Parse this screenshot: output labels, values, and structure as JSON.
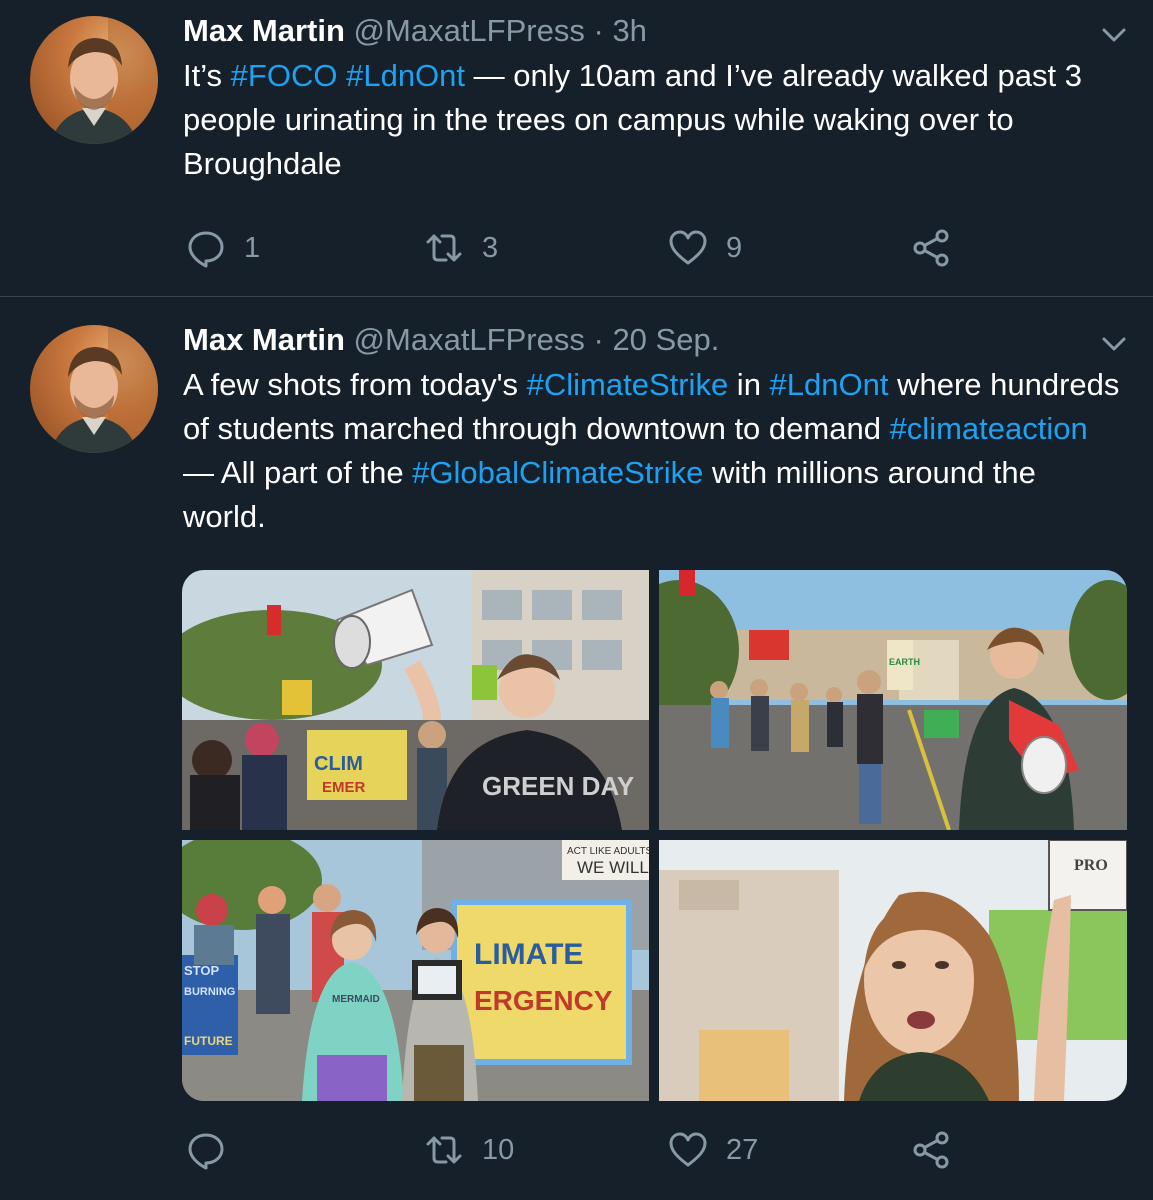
{
  "tweets": [
    {
      "author_name": "Max Martin",
      "handle": "@MaxatLFPress",
      "separator": "·",
      "time": "3h",
      "text_segments": [
        {
          "t": "It’s ",
          "tag": false
        },
        {
          "t": "#FOCO",
          "tag": true
        },
        {
          "t": " ",
          "tag": false
        },
        {
          "t": "#LdnOnt",
          "tag": true
        },
        {
          "t": " — only 10am and I’ve already walked past 3 people urinating in the trees on campus while waking over to Broughdale",
          "tag": false
        }
      ],
      "reply_count": "1",
      "retweet_count": "3",
      "like_count": "9"
    },
    {
      "author_name": "Max Martin",
      "handle": "@MaxatLFPress",
      "separator": "·",
      "time": "20 Sep.",
      "text_segments": [
        {
          "t": "A few shots from today's ",
          "tag": false
        },
        {
          "t": "#ClimateStrike",
          "tag": true
        },
        {
          "t": " in ",
          "tag": false
        },
        {
          "t": "#LdnOnt",
          "tag": true
        },
        {
          "t": " where hundreds of students marched through downtown to demand ",
          "tag": false
        },
        {
          "t": "#climateaction",
          "tag": true
        },
        {
          "t": " — All part of the ",
          "tag": false
        },
        {
          "t": "#GlobalClimateStrike",
          "tag": true
        },
        {
          "t": " with millions around the world.",
          "tag": false
        }
      ],
      "reply_count": "",
      "retweet_count": "10",
      "like_count": "27",
      "photos": [
        {
          "signs": [
            "CLIM",
            "EMER"
          ],
          "shirt": "GREEN DAY"
        },
        {
          "signs": [
            "EARTH"
          ],
          "shirt": ""
        },
        {
          "signs": [
            "LIMATE",
            "ERGENCY",
            "STOP",
            "BURNING",
            "FUTURE",
            "ACT LIKE ADULTS",
            "WE WILL",
            "MERMAID"
          ],
          "shirt": ""
        },
        {
          "signs": [
            "PRO"
          ],
          "shirt": ""
        }
      ]
    }
  ],
  "icons": [
    "avatar",
    "chevron-down-icon",
    "reply-icon",
    "retweet-icon",
    "like-icon",
    "share-icon"
  ],
  "colors": {
    "background": "#15202b",
    "link": "#1da1f2",
    "muted": "#8899a6",
    "divider": "#38444d"
  }
}
